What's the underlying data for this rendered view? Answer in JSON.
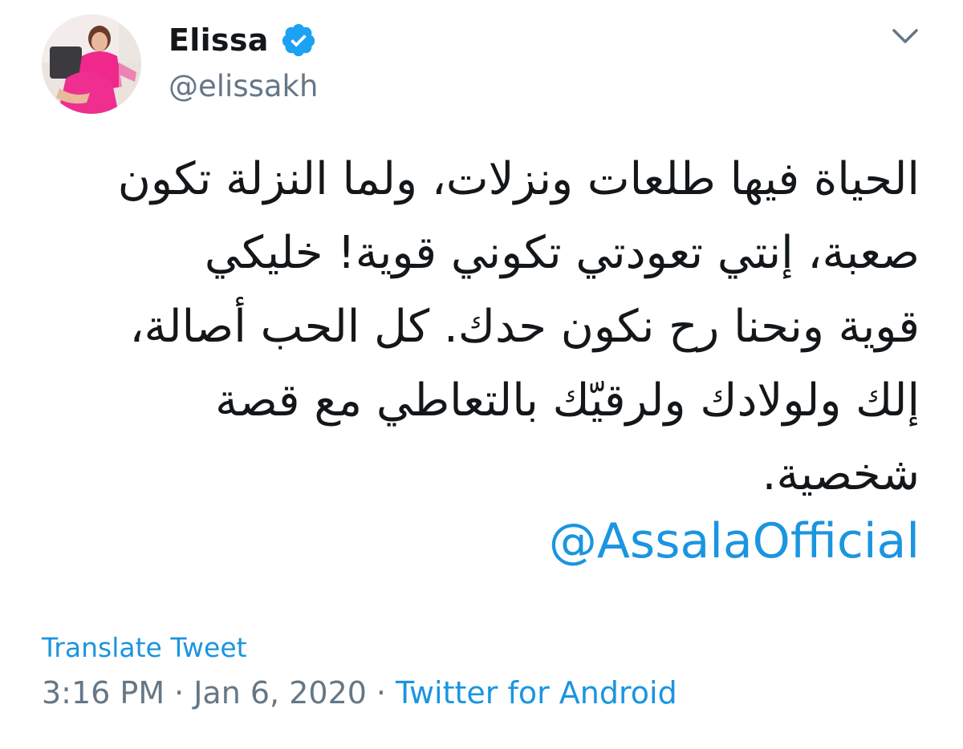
{
  "tweet": {
    "author": {
      "name": "Elissa",
      "handle": "@elissakh",
      "verified": true,
      "verified_color": "#1da1f2"
    },
    "text_lines": [
      "الحياة فيها طلعات ونزلات، ولما النزلة تكون",
      "صعبة، إنتي تعودتي تكوني قوية! خليكي",
      "قوية ونحنا رح نكون حدك. كل الحب أصالة،",
      "إلك ولولادك ولرقيّك بالتعاطي مع قصة",
      "شخصية."
    ],
    "mention": "@AssalaOfficial",
    "translate_label": "Translate Tweet",
    "time": "3:16 PM",
    "date": "Jan 6, 2020",
    "source": "Twitter for Android",
    "separator": "·",
    "separator2": "·",
    "colors": {
      "link": "#1b95e0",
      "secondary": "#657786",
      "primary": "#14171a"
    },
    "icons": {
      "caret": "chevron-down-icon",
      "verified": "verified-badge-icon"
    }
  }
}
